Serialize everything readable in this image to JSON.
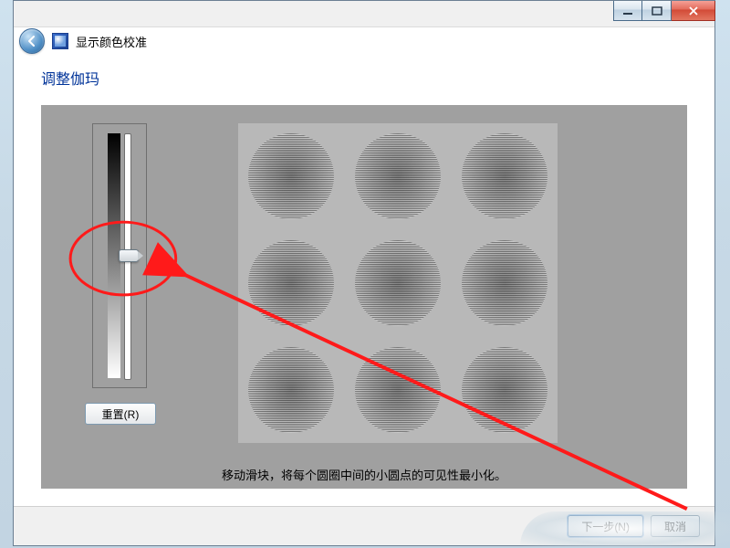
{
  "window": {
    "title": "显示颜色校准"
  },
  "page": {
    "heading": "调整伽玛",
    "instruction": "移动滑块，将每个圆圈中间的小圆点的可见性最小化。"
  },
  "controls": {
    "reset_label": "重置(R)",
    "next_label": "下一步(N)",
    "cancel_label": "取消"
  },
  "slider": {
    "min": 0,
    "max": 100,
    "value": 50
  },
  "icons": {
    "back": "back-arrow-icon",
    "minimize": "minimize-icon",
    "maximize": "maximize-icon",
    "close": "close-icon",
    "app": "display-calibration-icon"
  },
  "annotation": {
    "color": "#ff1a1a",
    "note": "red ellipse around slider thumb with arrow pointing from bottom-right to the thumb"
  }
}
